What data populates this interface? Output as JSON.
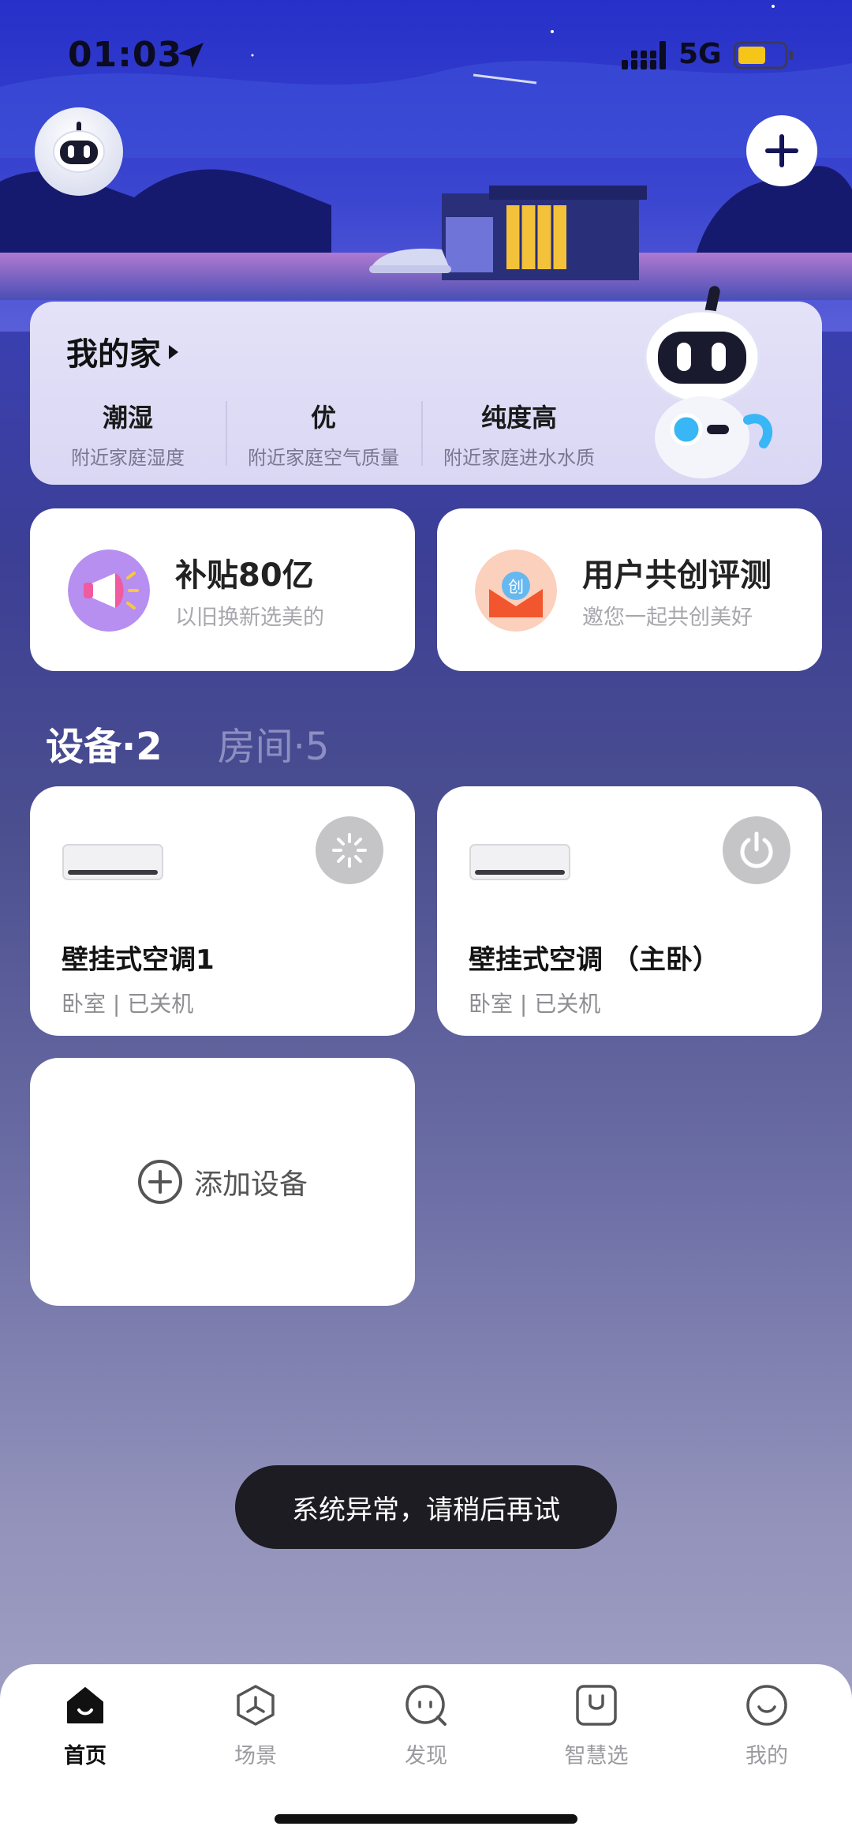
{
  "status_bar": {
    "time": "01:03",
    "network": "5G"
  },
  "home": {
    "title": "我的家",
    "stats": [
      {
        "value": "潮湿",
        "label": "附近家庭湿度"
      },
      {
        "value": "优",
        "label": "附近家庭空气质量"
      },
      {
        "value": "纯度高",
        "label": "附近家庭进水水质"
      }
    ]
  },
  "promos": [
    {
      "title": "补贴80亿",
      "subtitle": "以旧换新选美的",
      "icon": "megaphone-icon"
    },
    {
      "title": "用户共创评测",
      "subtitle": "邀您一起共创美好",
      "icon": "chuang-badge-icon",
      "badge_text": "创"
    }
  ],
  "tabs": {
    "devices": "设备·2",
    "rooms": "房间·5"
  },
  "devices": [
    {
      "name": "壁挂式空调1",
      "status": "卧室 | 已关机",
      "button_icon": "loading-spinner-icon"
    },
    {
      "name": "壁挂式空调 （主卧）",
      "status": "卧室 | 已关机",
      "button_icon": "power-icon"
    }
  ],
  "add_device_label": "添加设备",
  "toast": "系统异常，请稍后再试",
  "tabbar": [
    {
      "label": "首页",
      "icon": "home-icon",
      "active": true
    },
    {
      "label": "场景",
      "icon": "scene-icon",
      "active": false
    },
    {
      "label": "发现",
      "icon": "discover-icon",
      "active": false
    },
    {
      "label": "智慧选",
      "icon": "shop-bag-icon",
      "active": false
    },
    {
      "label": "我的",
      "icon": "profile-icon",
      "active": false
    }
  ],
  "colors": {
    "accent": "#2b2fb8",
    "toast_bg": "#1c1c22",
    "card_bg": "#ffffff"
  }
}
